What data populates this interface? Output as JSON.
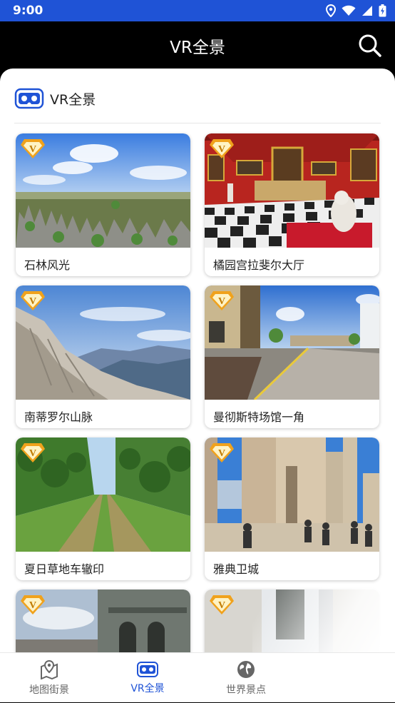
{
  "status_bar": {
    "time": "9:00"
  },
  "app_bar": {
    "title": "VR全景"
  },
  "section": {
    "title": "VR全景"
  },
  "cards": [
    {
      "label": "石林风光",
      "badge": "V"
    },
    {
      "label": "橘园宫拉斐尔大厅",
      "badge": "V"
    },
    {
      "label": "南蒂罗尔山脉",
      "badge": "V"
    },
    {
      "label": "曼彻斯特场馆一角",
      "badge": "V"
    },
    {
      "label": "夏日草地车辙印",
      "badge": "V"
    },
    {
      "label": "雅典卫城",
      "badge": "V"
    },
    {
      "label": "",
      "badge": "V"
    },
    {
      "label": "",
      "badge": "V"
    }
  ],
  "bottom_nav": [
    {
      "label": "地图街景"
    },
    {
      "label": "VR全景"
    },
    {
      "label": "世界景点"
    }
  ],
  "colors": {
    "accent": "#1f53d6",
    "badge": "#f0a21c"
  }
}
